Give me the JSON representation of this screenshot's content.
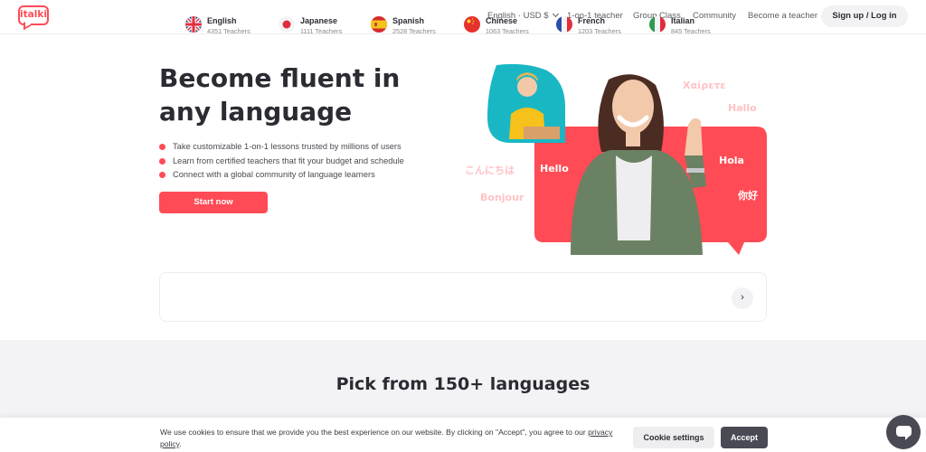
{
  "header": {
    "logo_text": "italki",
    "currency": "English · USD $",
    "nav": [
      "1-on-1 teacher",
      "Group Class",
      "Community",
      "Become a teacher"
    ],
    "signup_label": "Sign up / Log in"
  },
  "hero": {
    "title": "Become fluent in any language",
    "bullets": [
      "Take customizable 1-on-1 lessons trusted by millions of users",
      "Learn from certified teachers that fit your budget and schedule",
      "Connect with a global community of language learners"
    ],
    "cta_label": "Start now",
    "greetings": [
      "Χαίρετε",
      "Hallo",
      "こんにちは",
      "Hello",
      "Hola",
      "Bonjour",
      "你好"
    ]
  },
  "languages": {
    "items": [
      {
        "name": "English",
        "count": "4351 Teachers",
        "flag": "uk-flag-icon"
      },
      {
        "name": "Japanese",
        "count": "1111 Teachers",
        "flag": "japan-flag-icon"
      },
      {
        "name": "Spanish",
        "count": "2528 Teachers",
        "flag": "spain-flag-icon"
      },
      {
        "name": "Chinese",
        "count": "1063 Teachers",
        "flag": "china-flag-icon"
      },
      {
        "name": "French",
        "count": "1203 Teachers",
        "flag": "france-flag-icon"
      },
      {
        "name": "Italian",
        "count": "845 Teachers",
        "flag": "italy-flag-icon"
      }
    ],
    "next_icon": "chevron-right-icon"
  },
  "section": {
    "title": "Pick from 150+ languages"
  },
  "cookie": {
    "text": "We use cookies to ensure that we provide you the best experience on our website. By clicking on \"Accept\", you agree to our",
    "link": "privacy policy",
    "link_suffix": ".",
    "settings_label": "Cookie settings",
    "accept_label": "Accept"
  },
  "colors": {
    "brand": "#ff4b55",
    "dark": "#2b2b33",
    "section_bg": "#f3f3f6"
  }
}
